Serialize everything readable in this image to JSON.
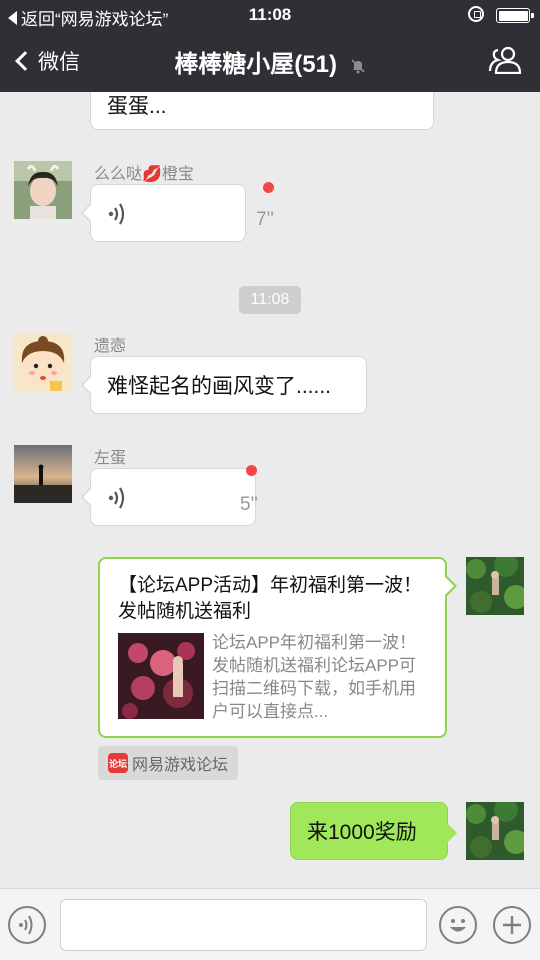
{
  "status_bar": {
    "back_label": "返回“网易游戏论坛”",
    "time": "11:08"
  },
  "nav": {
    "back_label": "微信",
    "title": "棒棒糖小屋(51)"
  },
  "messages": [
    {
      "type": "text",
      "side": "left",
      "text": "蛋蛋..."
    },
    {
      "type": "voice",
      "side": "left",
      "sender_name": "么么哒💋橙宝",
      "duration": "7''",
      "unread": true
    },
    {
      "type": "timestamp",
      "text": "11:08"
    },
    {
      "type": "text",
      "side": "left",
      "sender_name": "遗悫",
      "text": "难怪起名的画风变了......"
    },
    {
      "type": "voice",
      "side": "left",
      "sender_name": "左蛋",
      "duration": "5''",
      "unread": true
    },
    {
      "type": "link_card",
      "side": "right",
      "title": "【论坛APP活动】年初福利第一波！发帖随机送福利",
      "description": "论坛APP年初福利第一波！发帖随机送福利论坛APP可扫描二维码下载，如手机用户可以直接点...",
      "source": "网易游戏论坛",
      "source_logo_text": "论坛"
    },
    {
      "type": "text",
      "side": "right",
      "text": "来1000奖励"
    }
  ],
  "input_bar": {
    "placeholder": ""
  },
  "colors": {
    "nav_bg": "#2f3035",
    "chat_bg": "#ebebeb",
    "sent_bubble": "#a0e75a",
    "unread_dot": "#f04848"
  }
}
